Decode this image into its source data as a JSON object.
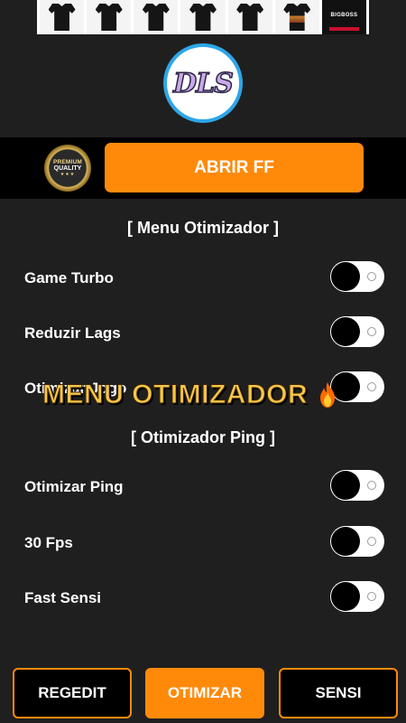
{
  "ad": {
    "brand_name": "BIGBOSS"
  },
  "logo": {
    "text": "DLS"
  },
  "premium_badge": {
    "line1": "PREMIUM",
    "line2": "QUALITY",
    "stars": "★★★"
  },
  "header": {
    "open_button_label": "ABRIR FF"
  },
  "menu_otimizador": {
    "title": "[ Menu Otimizador ]",
    "items": [
      {
        "label": "Game Turbo",
        "enabled": false
      },
      {
        "label": "Reduzir Lags",
        "enabled": false
      },
      {
        "label": "Otimizar Jogo",
        "enabled": false
      }
    ]
  },
  "overlay": {
    "text": "MENU OTIMIZADOR",
    "icon": "flame-icon"
  },
  "otimizador_ping": {
    "title": "[ Otimizador Ping ]",
    "items": [
      {
        "label": "Otimizar Ping",
        "enabled": false
      },
      {
        "label": "30 Fps",
        "enabled": false
      },
      {
        "label": "Fast Sensi",
        "enabled": false
      }
    ]
  },
  "bottom_nav": {
    "regedit_label": "REGEDIT",
    "otimizar_label": "OTIMIZAR",
    "sensi_label": "SENSI"
  },
  "colors": {
    "accent": "#ff8a0a",
    "background": "#1f1f1f",
    "header_band": "#000000",
    "overlay_text": "#f6c64a"
  }
}
